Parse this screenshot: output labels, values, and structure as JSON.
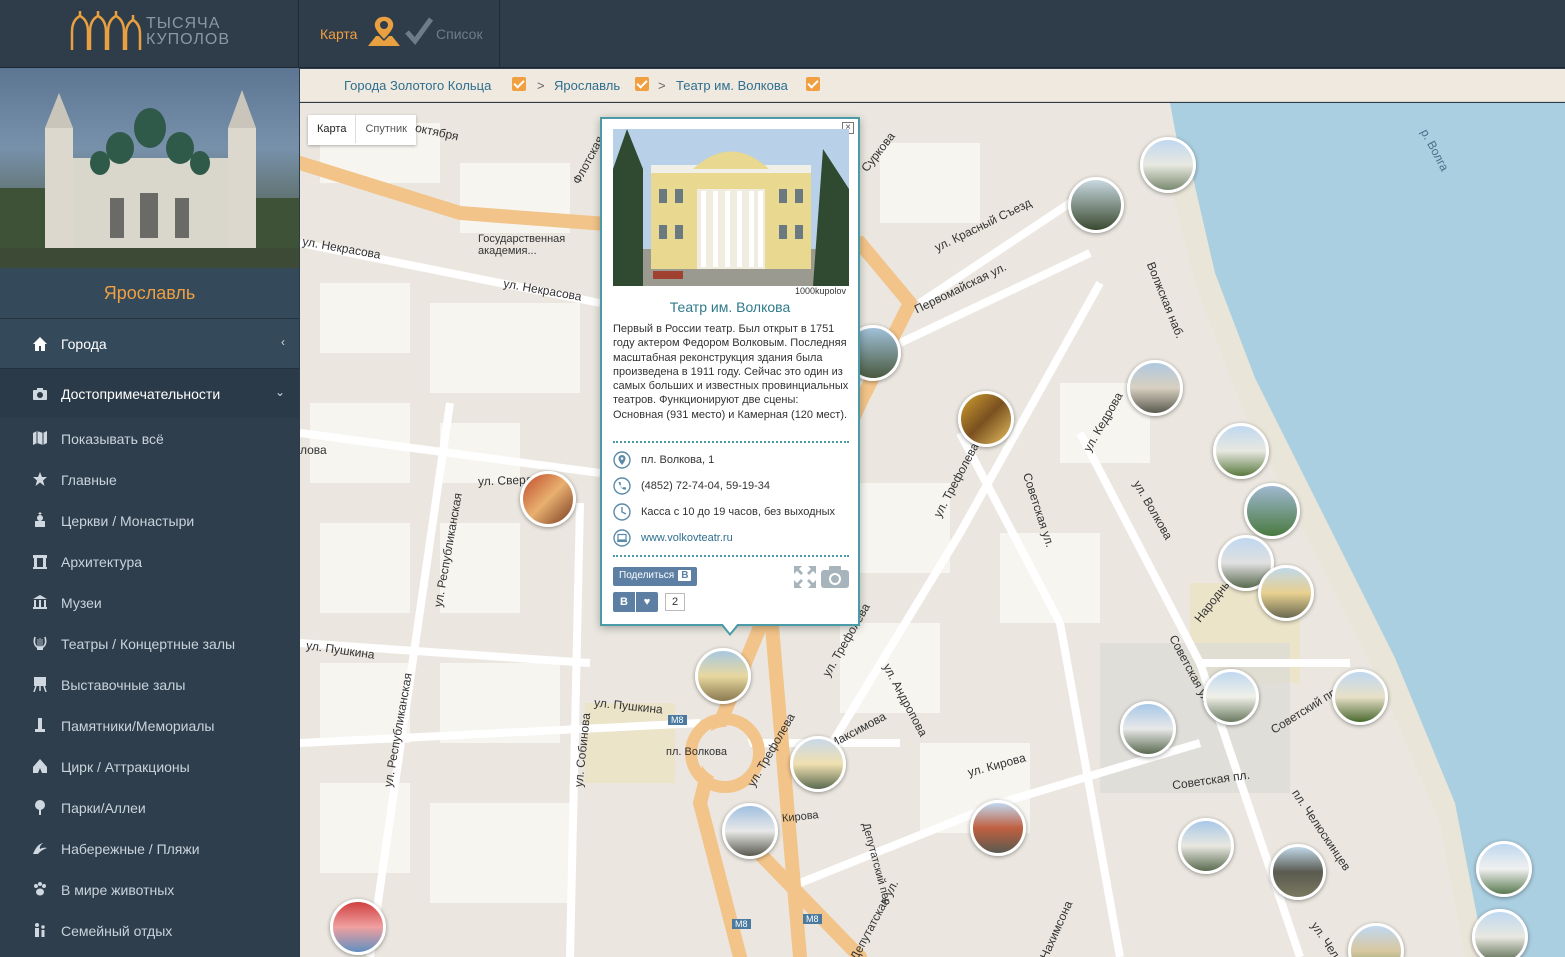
{
  "header": {
    "logo_line1": "ТЫСЯЧА",
    "logo_line2": "КУПОЛОВ",
    "tab_map": "Карта",
    "tab_list": "Список",
    "accent": "#f0a040"
  },
  "sidebar": {
    "city": "Ярославль",
    "main_items": [
      {
        "label": "Города",
        "icon": "home-icon",
        "chevron": "‹"
      },
      {
        "label": "Достопримечательности",
        "icon": "camera-icon",
        "chevron": "⌄"
      }
    ],
    "sub_items": [
      {
        "label": "Показывать всё",
        "icon": "map-icon"
      },
      {
        "label": "Главные",
        "icon": "star-icon"
      },
      {
        "label": "Церкви / Монастыри",
        "icon": "church-icon"
      },
      {
        "label": "Архитектура",
        "icon": "building-icon"
      },
      {
        "label": "Музеи",
        "icon": "museum-icon"
      },
      {
        "label": "Театры / Концертные залы",
        "icon": "lyre-icon"
      },
      {
        "label": "Выставочные залы",
        "icon": "easel-icon"
      },
      {
        "label": "Памятники/Мемориалы",
        "icon": "monument-icon"
      },
      {
        "label": "Цирк / Аттракционы",
        "icon": "circus-icon"
      },
      {
        "label": "Парки/Аллеи",
        "icon": "tree-icon"
      },
      {
        "label": "Набережные / Пляжи",
        "icon": "wave-icon"
      },
      {
        "label": "В мире животных",
        "icon": "paw-icon"
      },
      {
        "label": "Семейный отдых",
        "icon": "family-icon"
      }
    ]
  },
  "breadcrumb": {
    "items": [
      "Города Золотого Кольца",
      "Ярославль",
      "Театр им. Волкова"
    ],
    "separator": ">"
  },
  "map": {
    "type_map": "Карта",
    "type_satellite": "Спутник",
    "streets": [
      "ул. Некрасова",
      "ул. Некрасова",
      "Государственная академия...",
      "ул. Свердлова",
      "ул. Республиканская",
      "ул. Пушкина",
      "ул. Пушкина",
      "ул. Республиканская",
      "ул. Собинова",
      "пл. Волкова",
      "Максимова",
      "ул. Трефолева",
      "ул. Трефолева",
      "ул. Андропова",
      "ул. Кирова",
      "Кирова",
      "Депутатский пер",
      "Депутатская ул.",
      "Советская ул.",
      "ул. Трефолева",
      "ул. Кедрова",
      "ул. Волкова",
      "ул. Красный Съезд",
      "Первомайская ул.",
      "Волжская наб.",
      "Суркова",
      "Флотская",
      "р. Волга",
      "Народный",
      "Советская пл.",
      "Советская ул.",
      "Советский пр.",
      "пл. Челюскинцев",
      "ул. Чел",
      "Нахимсона",
      "М8",
      "М8",
      "М8",
      "октября",
      "лова"
    ]
  },
  "popup": {
    "photo_credit": "1000kupolov",
    "title": "Театр им. Волкова",
    "description": "Первый в России театр. Был открыт в 1751 году актером Федором Волковым. Последняя масштабная реконструкция здания была произведена в 1911 году. Сейчас это один из самых больших и известных провинциальных театров. Функционируют две сцены: Основная (931 место) и Камерная (120 мест).",
    "address": "пл. Волкова, 1",
    "phone": "(4852) 72-74-04, 59-19-34",
    "hours": "Касса с 10 до 19 часов, без выходных",
    "website": "www.volkovteatr.ru",
    "share_label": "Поделиться",
    "share_vk": "В",
    "like_vk": "В",
    "like_heart": "♥",
    "like_count": "2",
    "close": "×"
  }
}
